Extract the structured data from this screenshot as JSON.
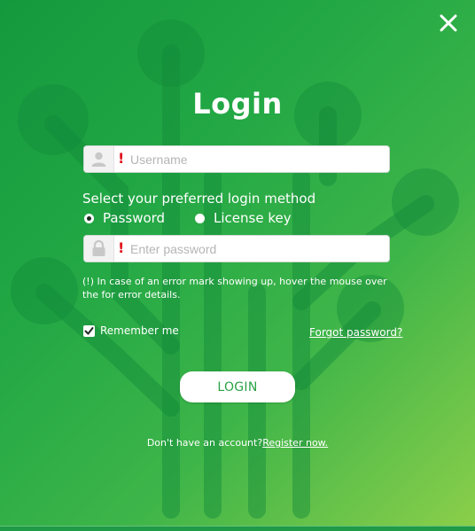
{
  "window": {
    "title": "Login",
    "close_icon": "close-icon"
  },
  "form": {
    "username": {
      "placeholder": "Username",
      "value": "",
      "icon": "user-icon",
      "error_mark": "!"
    },
    "method_label": "Select your preferred login method",
    "methods": [
      {
        "label": "Password",
        "selected": true
      },
      {
        "label": "License key",
        "selected": false
      }
    ],
    "password": {
      "placeholder": "Enter password",
      "value": "",
      "icon": "lock-icon",
      "error_mark": "!"
    },
    "hint": "(!) In case of an error mark showing up, hover the mouse over the for error details.",
    "remember_me": {
      "label": "Remember me",
      "checked": true
    },
    "forgot_password": "Forgot password?",
    "login_button": "LOGIN",
    "register_prompt": "Don't have an account?",
    "register_link": "Register now."
  },
  "colors": {
    "gradient_start": "#14993e",
    "gradient_end": "#8ccf4a",
    "error": "#e0141c",
    "button_text": "#2aa244"
  }
}
